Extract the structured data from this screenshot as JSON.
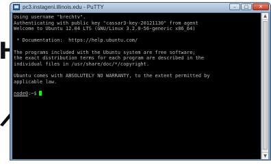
{
  "window": {
    "title": "pc3.instageni.illinois.edu - PuTTY",
    "icon": "putty-icon",
    "controls": {
      "minimize": "–",
      "maximize": "□",
      "close": "✕"
    }
  },
  "background": {
    "glyph": "H"
  },
  "terminal": {
    "lines": [
      "Using username \"brechtv\".",
      "Authenticating with public key \"cassar3-key-20121130\" from agent",
      "Welcome to Ubuntu 12.04 LTS (GNU/Linux 3.2.0-56-generic x86_64)",
      "",
      " * Documentation:  https://help.ubuntu.com/",
      "",
      "The programs included with the Ubuntu system are free software;",
      "the exact distribution terms for each program are described in the",
      "individual files in /usr/share/doc/*/copyright.",
      "",
      "Ubuntu comes with ABSOLUTELY NO WARRANTY, to the extent permitted by",
      "applicable law.",
      ""
    ],
    "prompt_host": "node0",
    "prompt_suffix": ":~$",
    "cursor_color": "#00ff00"
  },
  "colors": {
    "terminal_bg": "#000000",
    "terminal_fg": "#bbbbbb",
    "close_button": "#c2412a"
  }
}
